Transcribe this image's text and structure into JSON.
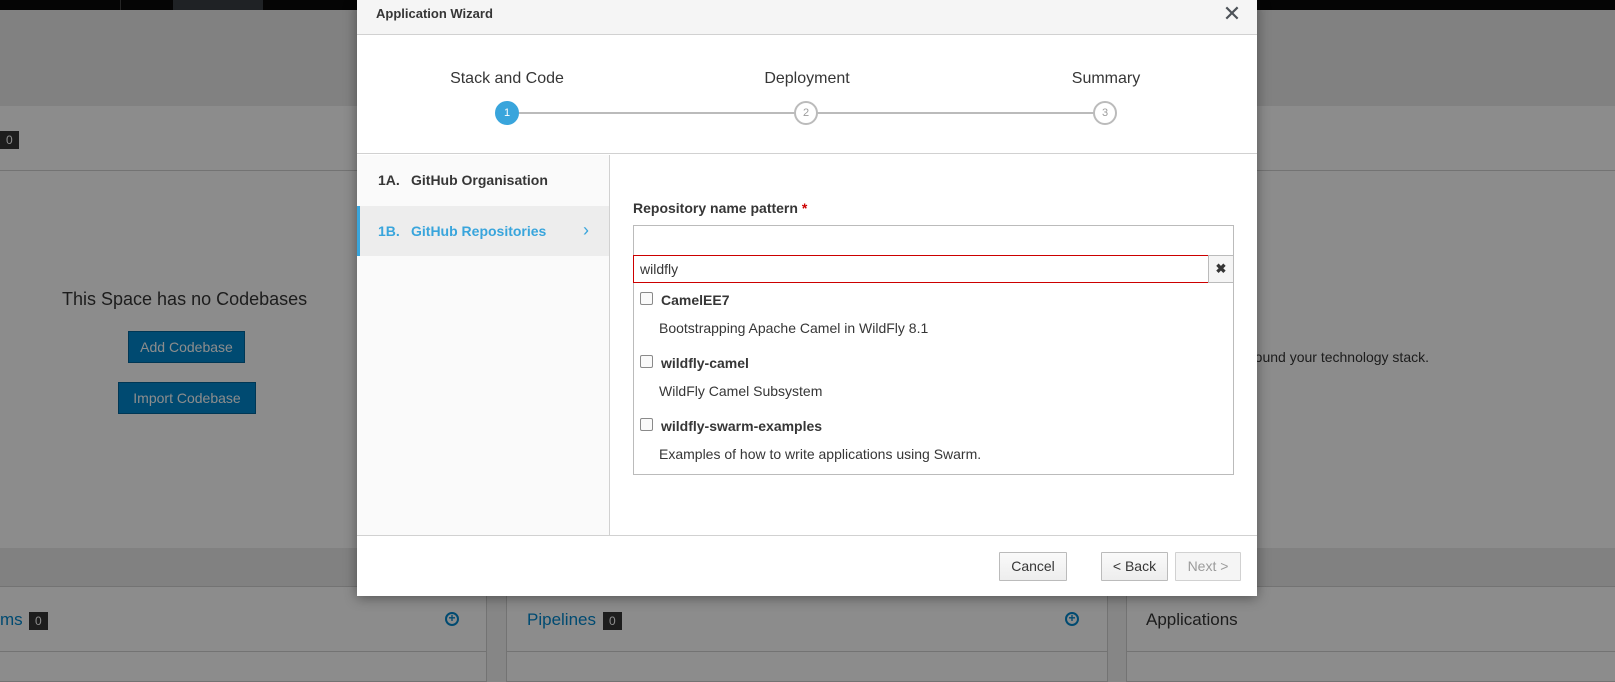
{
  "background": {
    "badge_top": "0",
    "no_codebases_text": "This Space has no Codebases",
    "add_codebase_label": "Add Codebase",
    "import_codebase_label": "Import Codebase",
    "right_text": "round your technology stack.",
    "cards": [
      {
        "title": "ms",
        "badge": "0"
      },
      {
        "title": "Pipelines",
        "badge": "0"
      },
      {
        "title": "Applications"
      }
    ],
    "plus_glyph": "+"
  },
  "modal": {
    "title": "Application Wizard",
    "close_glyph": "✕",
    "steps": [
      {
        "label": "Stack and Code",
        "number": "1"
      },
      {
        "label": "Deployment",
        "number": "2"
      },
      {
        "label": "Summary",
        "number": "3"
      }
    ],
    "sidebar": [
      {
        "num": "1A.",
        "label": "GitHub Organisation"
      },
      {
        "num": "1B.",
        "label": "GitHub Repositories",
        "chevron": "›"
      }
    ],
    "field": {
      "label": "Repository name pattern",
      "required_mark": "*",
      "search_value": "wildfly",
      "clear_glyph": "✖"
    },
    "repositories": [
      {
        "name": "CamelEE7",
        "description": "Bootstrapping Apache Camel in WildFly 8.1"
      },
      {
        "name": "wildfly-camel",
        "description": "WildFly Camel Subsystem"
      },
      {
        "name": "wildfly-swarm-examples",
        "description": "Examples of how to write applications using Swarm."
      }
    ],
    "footer": {
      "cancel_label": "Cancel",
      "back_label": "< Back",
      "next_label": "Next >"
    }
  }
}
